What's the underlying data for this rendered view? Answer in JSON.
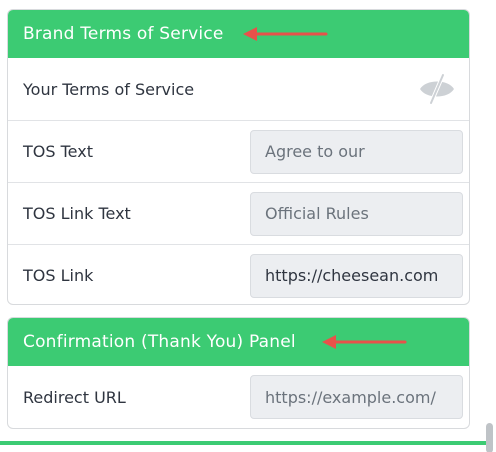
{
  "sections": {
    "brand_terms": {
      "title": "Brand Terms of Service",
      "rows": {
        "your_tos": {
          "label": "Your Terms of Service",
          "icon": "eye-slash-icon"
        },
        "tos_text": {
          "label": "TOS Text",
          "placeholder": "Agree to our",
          "value": ""
        },
        "tos_link_text": {
          "label": "TOS Link Text",
          "placeholder": "Official Rules",
          "value": ""
        },
        "tos_link": {
          "label": "TOS Link",
          "placeholder": "",
          "value": "https://cheesean.com"
        }
      }
    },
    "confirmation": {
      "title": "Confirmation (Thank You) Panel",
      "rows": {
        "redirect_url": {
          "label": "Redirect URL",
          "placeholder": "https://example.com/",
          "value": ""
        }
      }
    }
  },
  "colors": {
    "header_green": "#3ccb73",
    "annotation_arrow": "#e8524a",
    "field_bg": "#eceef1"
  }
}
